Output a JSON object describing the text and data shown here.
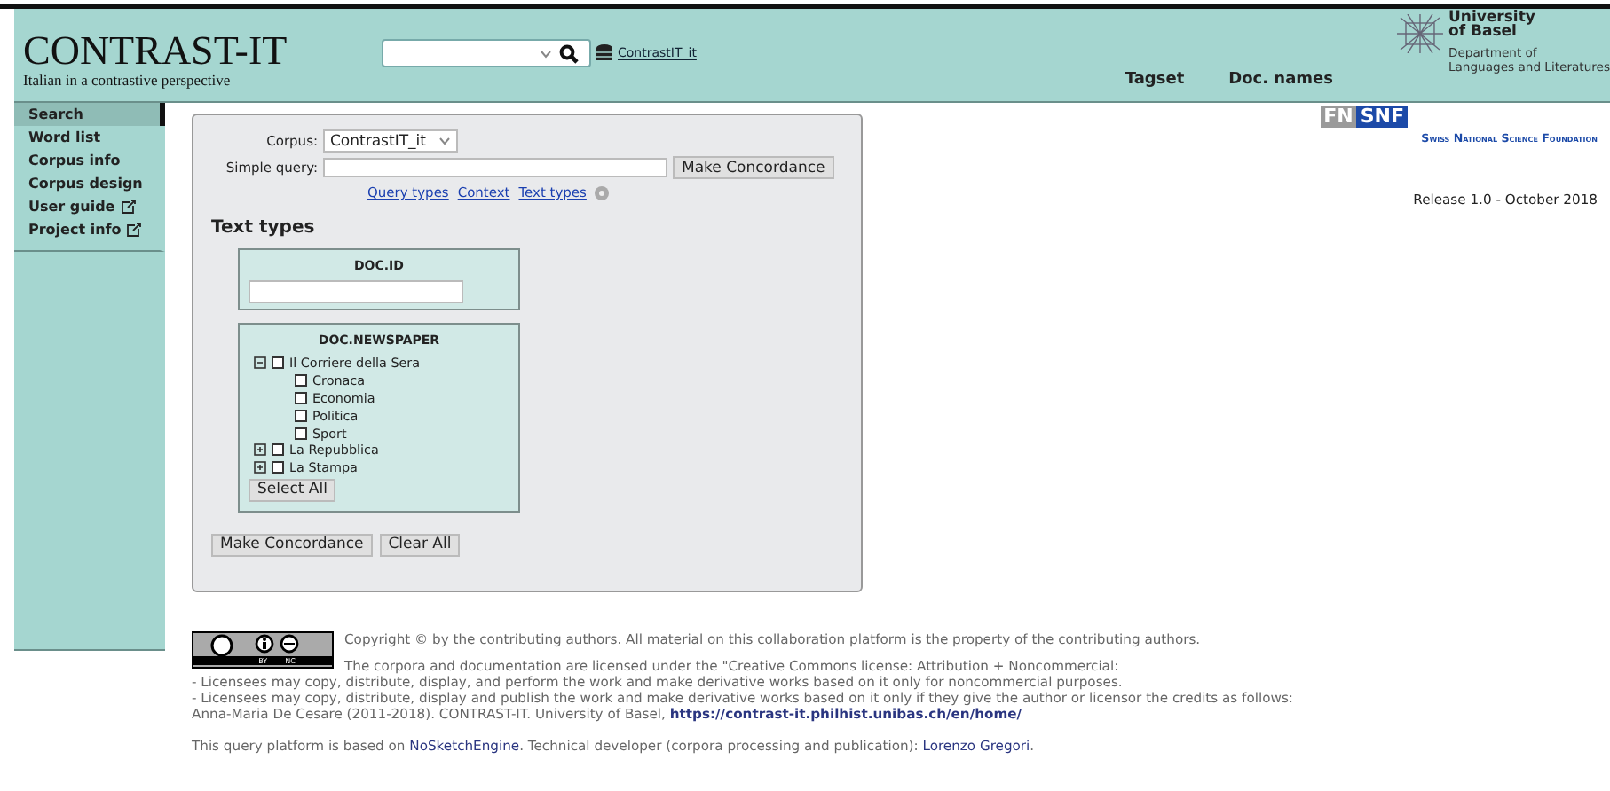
{
  "header": {
    "title": "CONTRAST-IT",
    "subtitle": "Italian in a contrastive perspective",
    "corpus_link": "ContrastIT_it",
    "nav": [
      "Tagset",
      "Doc. names"
    ],
    "university": {
      "name_line_1": "University",
      "name_line_2": "of Basel",
      "dept_line_1": "Department of",
      "dept_line_2": "Languages and Literatures"
    }
  },
  "sidebar": {
    "items": [
      {
        "label": "Search",
        "selected": true,
        "external": false
      },
      {
        "label": "Word list",
        "selected": false,
        "external": false
      },
      {
        "label": "Corpus info",
        "selected": false,
        "external": false
      },
      {
        "label": "Corpus design",
        "selected": false,
        "external": false
      },
      {
        "label": "User guide",
        "selected": false,
        "external": true
      },
      {
        "label": "Project info",
        "selected": false,
        "external": true
      }
    ]
  },
  "form": {
    "corpus_label": "Corpus:",
    "corpus_value": "ContrastIT_it",
    "query_label": "Simple query:",
    "make_button": "Make Concordance",
    "links": [
      "Query types",
      "Context",
      "Text types"
    ],
    "text_types_heading": "Text types",
    "doc_id": {
      "title": "DOC.ID"
    },
    "newspaper": {
      "title": "DOC.NEWSPAPER",
      "tree": [
        {
          "label": "Il Corriere della Sera",
          "expanded": true,
          "checked": false,
          "children": [
            {
              "label": "Cronaca",
              "checked": false
            },
            {
              "label": "Economia",
              "checked": false
            },
            {
              "label": "Politica",
              "checked": false
            },
            {
              "label": "Sport",
              "checked": false
            }
          ]
        },
        {
          "label": "La Repubblica",
          "expanded": false,
          "checked": false
        },
        {
          "label": "La Stampa",
          "expanded": false,
          "checked": false
        }
      ],
      "select_all": "Select All"
    },
    "buttons": [
      "Make Concordance",
      "Clear All"
    ]
  },
  "funder": {
    "logo_left": "FN",
    "logo_right": "SNF",
    "name": "Swiss National Science Foundation"
  },
  "release": "Release 1.0 - October 2018",
  "footer": {
    "cc_labels": [
      "BY",
      "NC"
    ],
    "copyright": "Copyright © by the contributing authors. All material on this collaboration platform is the property of the contributing authors.",
    "license_lines": [
      "The corpora and documentation are licensed under the \"Creative Commons license: Attribution + Noncommercial:",
      "- Licensees may copy, distribute, display, and perform the work and make derivative works based on it only for noncommercial purposes.",
      "- Licensees may copy, distribute, display and publish the work and make derivative works based on it only if they give the author or licensor the credits as follows:"
    ],
    "credit": "Anna-Maria De Cesare (2011-2018). CONTRAST-IT. University of Basel,",
    "credit_link": "https://contrast-it.philhist.unibas.ch/en/home/",
    "platform_before": "This query platform is based on",
    "platform_link": "NoSketchEngine",
    "platform_middle": ". Technical developer (corpora processing and publication):",
    "developer_link": "Lorenzo Gregori",
    "platform_end": "."
  }
}
